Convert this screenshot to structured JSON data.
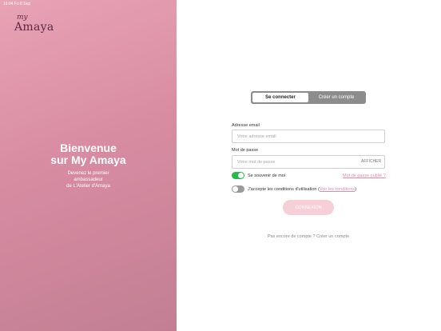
{
  "status_bar": {
    "time": "16:04   Fri 8 Sep"
  },
  "brand": {
    "logo_my": "my",
    "logo_name": "Amaya"
  },
  "welcome": {
    "title_line1": "Bienvenue",
    "title_line2": "sur My Amaya",
    "subtitle_lines": [
      "Devenez le premier",
      "ambassadeur",
      "de L'Atelier d'Amaya"
    ]
  },
  "tabs": [
    {
      "label": "Se connecter",
      "active": true
    },
    {
      "label": "Créer un compte",
      "active": false
    }
  ],
  "form": {
    "email_label": "Adresse email",
    "email_placeholder": "Votre adresse email",
    "password_label": "Mot de passe",
    "password_placeholder": "Votre mot de passe",
    "show_password": "AFFICHER",
    "remember_label": "Se souvenir de moi",
    "remember_on": true,
    "forgot_password": "Mot de passe oublié ?",
    "terms_prefix": "J'accepte les conditions d'utilisation (",
    "terms_link": "Voir les conditions",
    "terms_suffix": ")",
    "terms_on": false,
    "submit": "CONNEXION"
  },
  "footer": {
    "no_account_prefix": "Pas encore de compte ?",
    "create_account": "Créer un compte"
  },
  "colors": {
    "left_panel": "#d88ca2",
    "toggle_on": "#2bb84a",
    "toggle_off": "#9a9a9a",
    "link": "#e38aa6",
    "button_disabled": "#f6cfd8"
  }
}
